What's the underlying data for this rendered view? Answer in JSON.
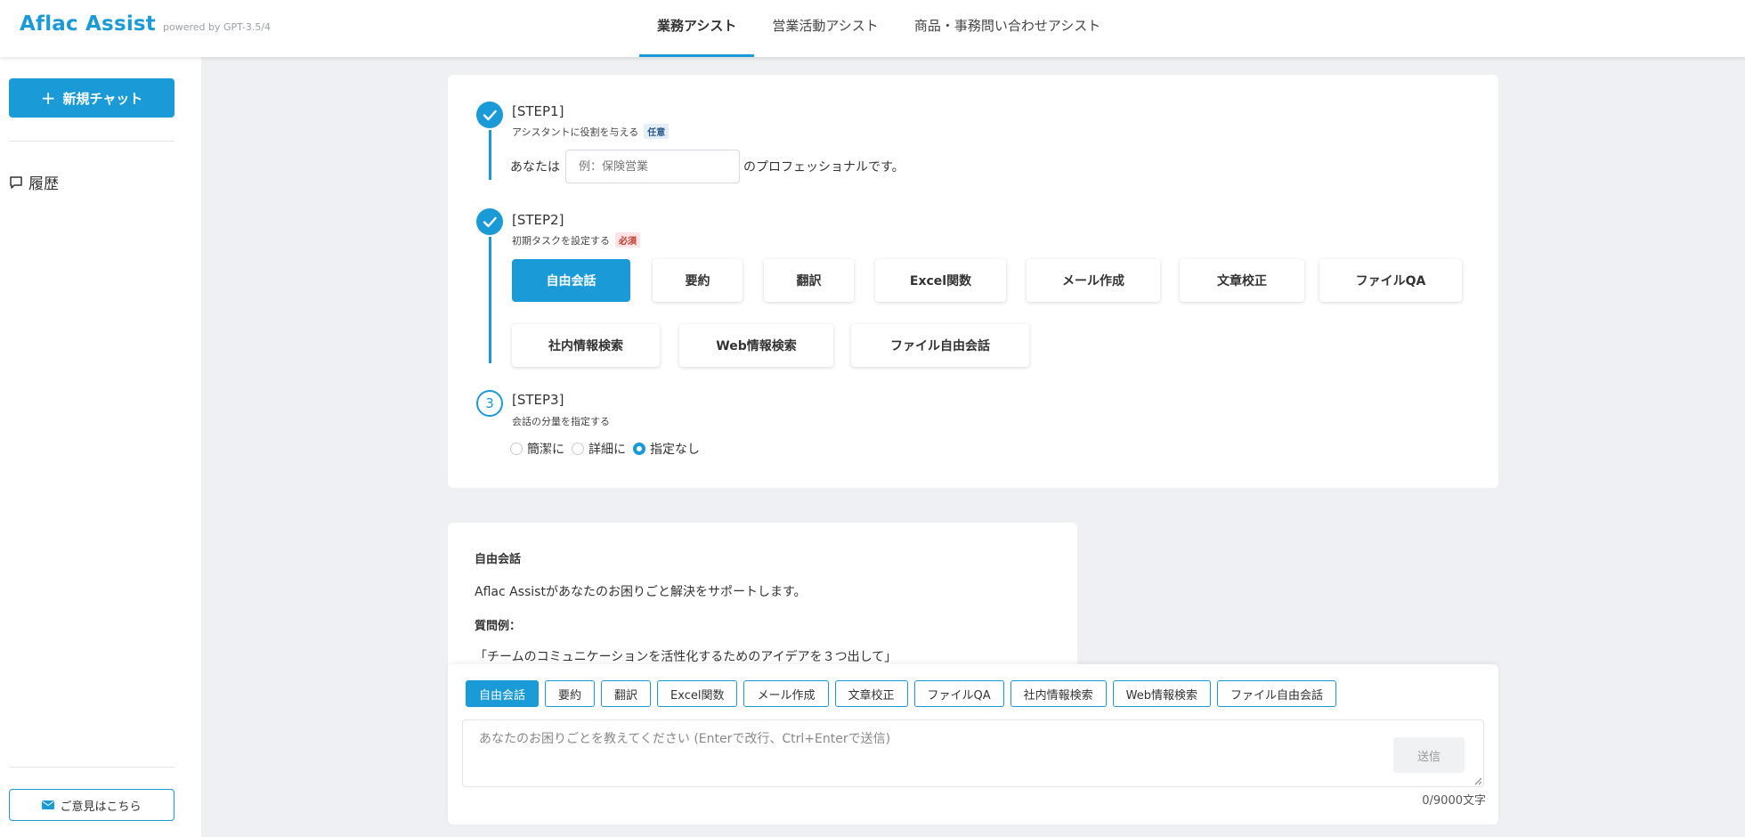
{
  "header": {
    "brand": "Aflac Assist",
    "brand_sub": "powered by GPT-3.5/4",
    "tabs": [
      {
        "label": "業務アシスト",
        "active": true
      },
      {
        "label": "営業活動アシスト",
        "active": false
      },
      {
        "label": "商品・事務問い合わせアシスト",
        "active": false
      }
    ]
  },
  "sidebar": {
    "new_chat": "新規チャット",
    "history": "履歴",
    "feedback": "ご意見はこちら"
  },
  "steps": {
    "step1": {
      "title": "[STEP1]",
      "desc": "アシスタントに役割を与える",
      "badge": "任意",
      "prefix": "あなたは",
      "placeholder": "例：保険営業",
      "suffix": "のプロフェッショナルです。"
    },
    "step2": {
      "title": "[STEP2]",
      "desc": "初期タスクを設定する",
      "badge": "必須",
      "tasks": [
        "自由会話",
        "要約",
        "翻訳",
        "Excel関数",
        "メール作成",
        "文章校正",
        "ファイルQA",
        "社内情報検索",
        "Web情報検索",
        "ファイル自由会話"
      ],
      "selected": "自由会話"
    },
    "step3": {
      "number": "3",
      "title": "[STEP3]",
      "desc": "会話の分量を指定する",
      "options": [
        "簡潔に",
        "詳細に",
        "指定なし"
      ],
      "selected": "指定なし"
    }
  },
  "intro": {
    "title": "自由会話",
    "text": "Aflac Assistがあなたのお困りごと解決をサポートします。",
    "example_label": "質問例：",
    "example": "「チームのコミュニケーションを活性化するためのアイデアを３つ出して」"
  },
  "composer": {
    "chips": [
      "自由会話",
      "要約",
      "翻訳",
      "Excel関数",
      "メール作成",
      "文章校正",
      "ファイルQA",
      "社内情報検索",
      "Web情報検索",
      "ファイル自由会話"
    ],
    "active_chip": "自由会話",
    "placeholder": "あなたのお困りごとを教えてください (Enterで改行、Ctrl+Enterで送信)",
    "send": "送信",
    "counter": "0/9000文字"
  },
  "colors": {
    "accent": "#1a9ad6",
    "required_badge": "#fde3e3",
    "optional_badge": "#e4eef7",
    "background": "#eef0f3"
  }
}
